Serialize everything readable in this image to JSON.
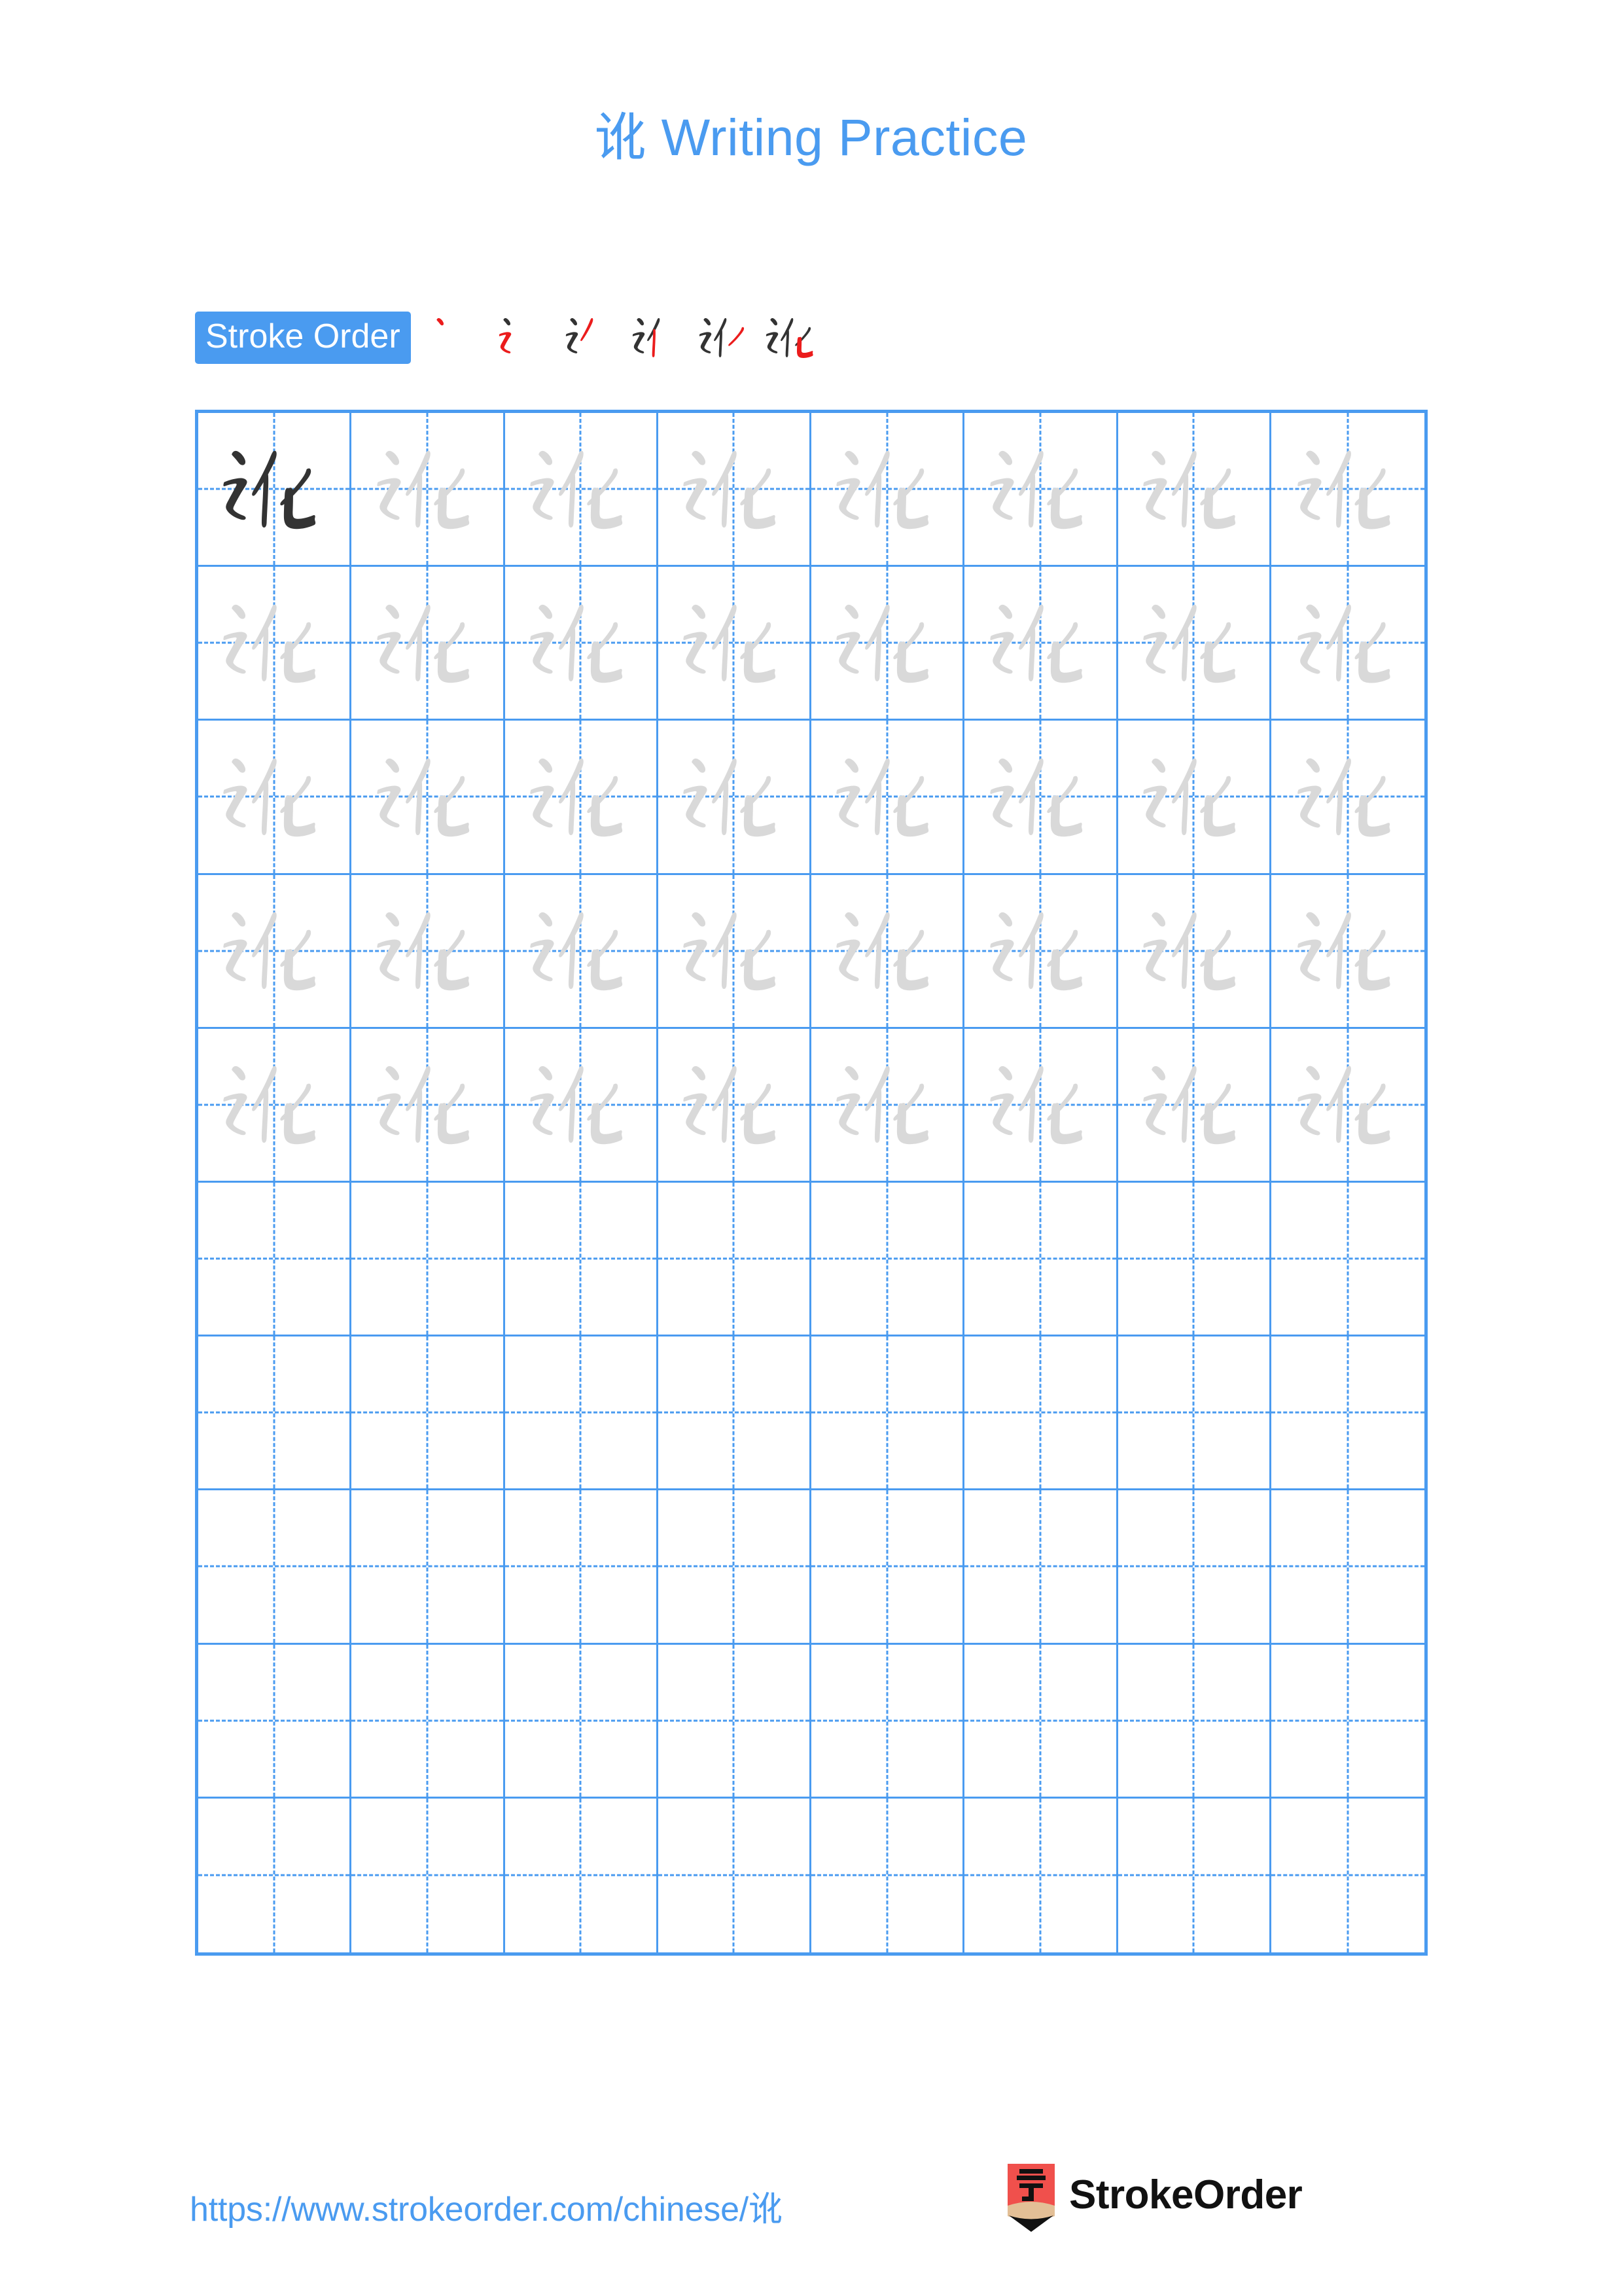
{
  "character": "讹",
  "title": "讹 Writing Practice",
  "colors": {
    "accent_blue": "#4a9bf0",
    "grid_line": "#4a9bf0",
    "model_char": "#333333",
    "trace_char": "#d9d9d9",
    "stroke_done": "#333333",
    "stroke_new": "#eb1c1c",
    "logo_red": "#f0504c",
    "logo_wood": "#e3bf96",
    "brand_text": "#111111"
  },
  "stroke_order": {
    "label": "Stroke Order",
    "stroke_count": 6,
    "steps": [
      {
        "index": 1,
        "new_stroke_name": "dian",
        "cumulative": "丶"
      },
      {
        "index": 2,
        "new_stroke_name": "hengzhe-tiao",
        "cumulative": "讠"
      },
      {
        "index": 3,
        "new_stroke_name": "pie",
        "cumulative": "讠丿"
      },
      {
        "index": 4,
        "new_stroke_name": "shu",
        "cumulative": "讠亻"
      },
      {
        "index": 5,
        "new_stroke_name": "pie",
        "cumulative": "讠亻丿"
      },
      {
        "index": 6,
        "new_stroke_name": "shuwangou",
        "cumulative": "讹"
      }
    ]
  },
  "grid": {
    "columns": 8,
    "rows": 10,
    "filled_rows": 5,
    "empty_rows": 5,
    "model_cell_index": 0,
    "guides": "dashed-crosshair"
  },
  "footer": {
    "url": "https://www.strokeorder.com/chinese/讹",
    "brand_name": "StrokeOrder",
    "logo_glyph": "字",
    "logo_icon_name": "pencil-logo-icon"
  }
}
